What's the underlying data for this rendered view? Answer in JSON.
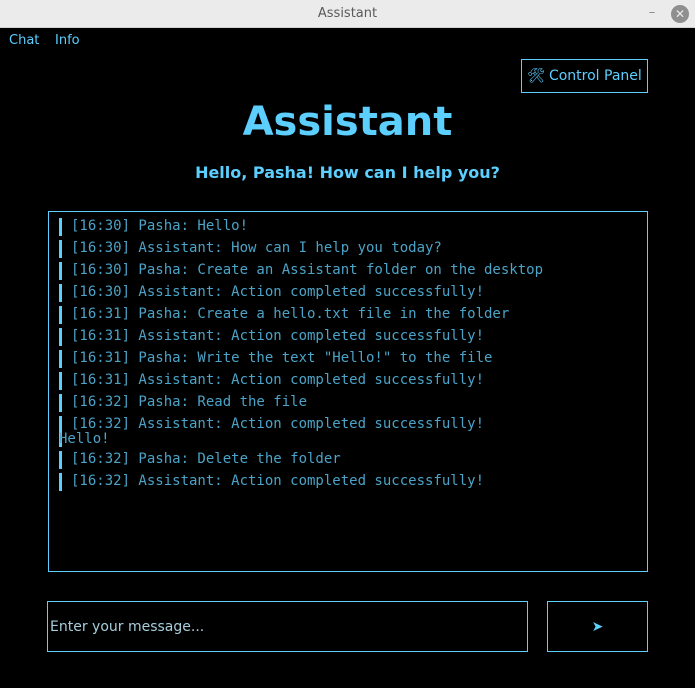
{
  "window": {
    "title": "Assistant",
    "minimize_glyph": "–",
    "close_glyph": "✕"
  },
  "menu": {
    "items": [
      {
        "label": "Chat"
      },
      {
        "label": "Info"
      }
    ]
  },
  "toolbar": {
    "control_panel_icon": "🛠",
    "control_panel_label": "Control Panel"
  },
  "header": {
    "title": "Assistant",
    "greeting": "Hello, Pasha! How can I help you?"
  },
  "chat": {
    "messages": [
      {
        "text": "[16:30] Pasha: Hello!"
      },
      {
        "text": "[16:30] Assistant: How can I help you today?"
      },
      {
        "text": "[16:30] Pasha: Create an Assistant folder on the desktop"
      },
      {
        "text": "[16:30] Assistant: Action completed successfully!"
      },
      {
        "text": "[16:31] Pasha: Create a hello.txt file in the folder"
      },
      {
        "text": "[16:31] Assistant: Action completed successfully!"
      },
      {
        "text": "[16:31] Pasha: Write the text \"Hello!\" to the file"
      },
      {
        "text": "[16:31] Assistant: Action completed successfully!"
      },
      {
        "text": "[16:32] Pasha: Read the file"
      },
      {
        "text": "[16:32] Assistant: Action completed successfully!",
        "continuation": "Hello!"
      },
      {
        "text": "[16:32] Pasha: Delete the folder"
      },
      {
        "text": "[16:32] Assistant: Action completed successfully!"
      }
    ]
  },
  "composer": {
    "placeholder": "Enter your message...",
    "value": "",
    "send_glyph": "➤",
    "send_icon": "send-icon"
  },
  "colors": {
    "accent": "#5ccfff",
    "message_text": "#4ba3c7",
    "background": "#000000"
  }
}
